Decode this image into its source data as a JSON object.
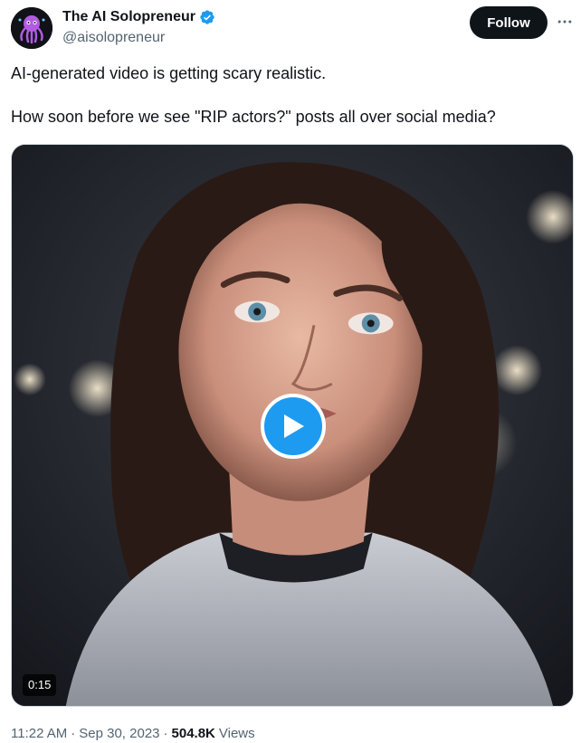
{
  "author": {
    "display_name": "The AI Solopreneur",
    "handle": "@aisolopreneur",
    "verified": true,
    "avatar_icon": "octopus-logo",
    "verified_color": "#1d9bf0"
  },
  "actions": {
    "follow_label": "Follow",
    "more_icon": "more-horizontal-icon"
  },
  "tweet": {
    "line1": "AI-generated video is getting scary realistic.",
    "line2": "How soon before we see \"RIP actors?\" posts all over social media?"
  },
  "video": {
    "duration": "0:15",
    "play_icon": "play-icon",
    "accent": "#1d9bf0"
  },
  "meta": {
    "time": "11:22 AM",
    "separator1": "·",
    "date": "Sep 30, 2023",
    "separator2": "·",
    "views_count": "504.8K",
    "views_label": "Views"
  }
}
